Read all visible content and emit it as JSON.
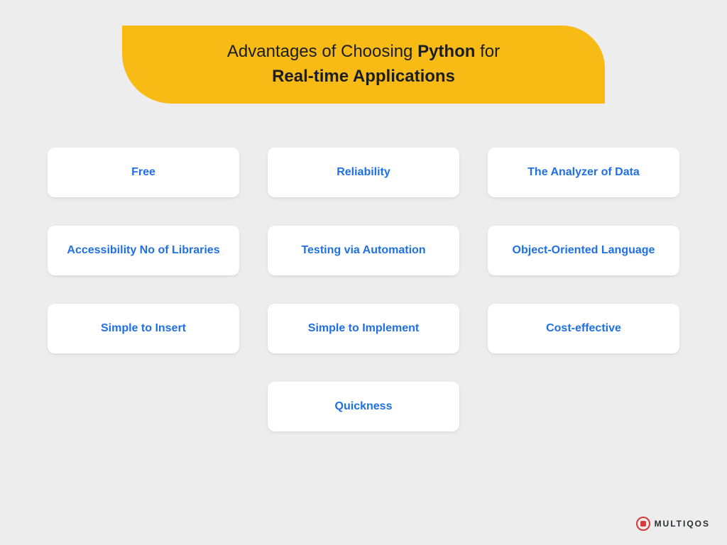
{
  "title": {
    "line1_prefix": "Advantages of Choosing ",
    "line1_bold": "Python",
    "line1_suffix": " for",
    "line2": "Real-time Applications"
  },
  "cards": {
    "r0c0": "Free",
    "r0c1": "Reliability",
    "r0c2": "The Analyzer of Data",
    "r1c0": "Accessibility No of Libraries",
    "r1c1": "Testing via Automation",
    "r1c2": "Object-Oriented Language",
    "r2c0": "Simple to Insert",
    "r2c1": "Simple to Implement",
    "r2c2": "Cost-effective",
    "r3c0": "Quickness"
  },
  "logo": {
    "text": "MULTIQOS"
  },
  "colors": {
    "banner": "#f8bb16",
    "card_text": "#1f6fe5",
    "bg": "#ededed"
  }
}
